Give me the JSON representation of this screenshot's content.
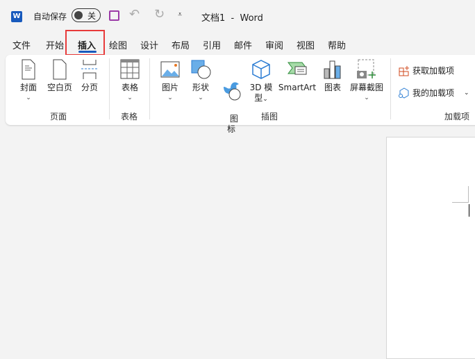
{
  "titlebar": {
    "autosave_label": "自动保存",
    "autosave_state": "关",
    "doc_title": "文档1  -  Word"
  },
  "tabs": [
    "文件",
    "开始",
    "插入",
    "绘图",
    "设计",
    "布局",
    "引用",
    "邮件",
    "审阅",
    "视图",
    "帮助"
  ],
  "active_tab": "插入",
  "ribbon": {
    "pages": {
      "label": "页面",
      "items": [
        "封面",
        "空白页",
        "分页"
      ]
    },
    "tables": {
      "label": "表格",
      "items": [
        "表格"
      ]
    },
    "illustrations": {
      "label": "插图",
      "items": [
        "图片",
        "形状",
        "图\n标",
        "3D 模",
        "型",
        "SmartArt",
        "图表",
        "屏幕截图"
      ]
    },
    "addins": {
      "label": "加载项",
      "items": [
        "获取加载项",
        "我的加载项"
      ]
    }
  },
  "colors": {
    "accent": "#185abd",
    "highlight": "#e83a3a",
    "save": "#9b3aa7"
  }
}
